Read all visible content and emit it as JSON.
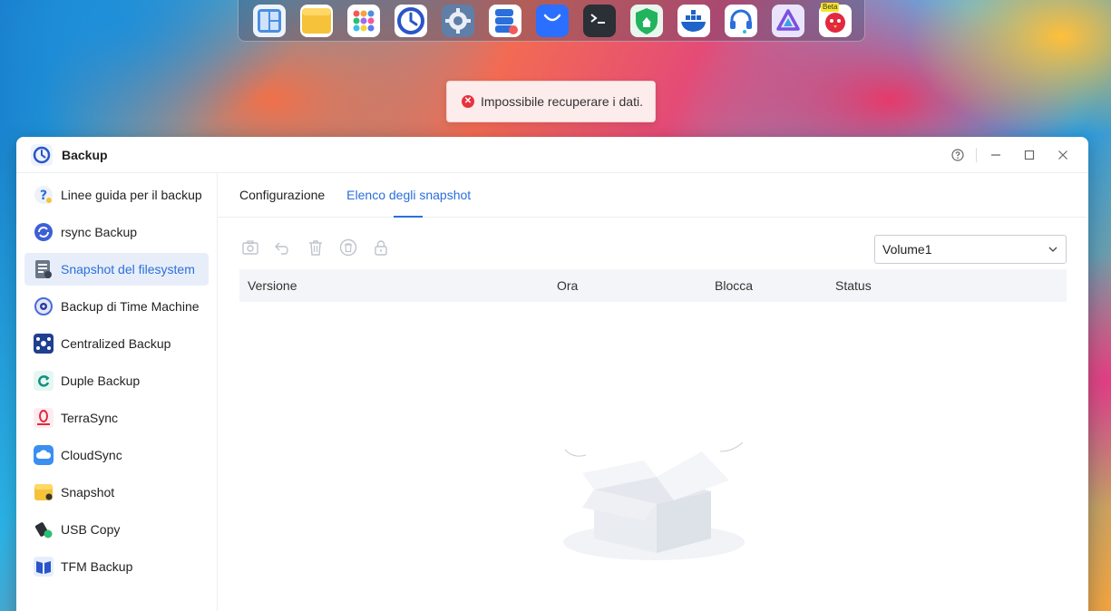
{
  "dock": {
    "apps": [
      {
        "name": "file-manager-app",
        "icon": "layout-grid-icon"
      },
      {
        "name": "notes-app",
        "icon": "folder-icon"
      },
      {
        "name": "app-center-app",
        "icon": "apps-grid-icon"
      },
      {
        "name": "backup-app",
        "icon": "clock-backup-icon"
      },
      {
        "name": "settings-app",
        "icon": "gear-icon"
      },
      {
        "name": "storage-manager-app",
        "icon": "database-icon"
      },
      {
        "name": "store-app",
        "icon": "shopping-bag-icon"
      },
      {
        "name": "terminal-app",
        "icon": "terminal-icon"
      },
      {
        "name": "security-app",
        "icon": "shield-icon"
      },
      {
        "name": "docker-app",
        "icon": "docker-icon"
      },
      {
        "name": "support-app",
        "icon": "headset-icon"
      },
      {
        "name": "jellyfin-app",
        "icon": "triangle-media-icon"
      },
      {
        "name": "beta-app",
        "icon": "bird-icon",
        "badge": "Beta"
      }
    ]
  },
  "toast": {
    "message": "Impossibile recuperare i dati.",
    "icon": "error-circle-icon",
    "color": "#e8323c"
  },
  "window": {
    "title": "Backup",
    "accent": "#2a6fdb"
  },
  "sidebar": {
    "items": [
      {
        "label": "Linee guida per il backup",
        "icon": "help-guide-icon"
      },
      {
        "label": "rsync Backup",
        "icon": "rsync-icon"
      },
      {
        "label": "Snapshot del filesystem",
        "icon": "filesystem-snapshot-icon",
        "active": true
      },
      {
        "label": "Backup di Time Machine",
        "icon": "time-machine-icon"
      },
      {
        "label": "Centralized Backup",
        "icon": "centralized-backup-icon"
      },
      {
        "label": "Duple Backup",
        "icon": "duple-backup-icon"
      },
      {
        "label": "TerraSync",
        "icon": "terrasync-icon"
      },
      {
        "label": "CloudSync",
        "icon": "cloudsync-icon"
      },
      {
        "label": "Snapshot",
        "icon": "snapshot-folder-icon"
      },
      {
        "label": "USB Copy",
        "icon": "usb-copy-icon"
      },
      {
        "label": "TFM Backup",
        "icon": "tfm-backup-icon"
      }
    ]
  },
  "tabs": [
    {
      "label": "Configurazione"
    },
    {
      "label": "Elenco degli snapshot",
      "active": true
    }
  ],
  "toolbar": {
    "buttons": [
      "camera-icon",
      "undo-icon",
      "trash-icon",
      "delete-all-icon",
      "lock-icon"
    ]
  },
  "volume_select": {
    "value": "Volume1"
  },
  "table": {
    "columns": [
      "Versione",
      "Ora",
      "Blocca",
      "Status"
    ]
  }
}
